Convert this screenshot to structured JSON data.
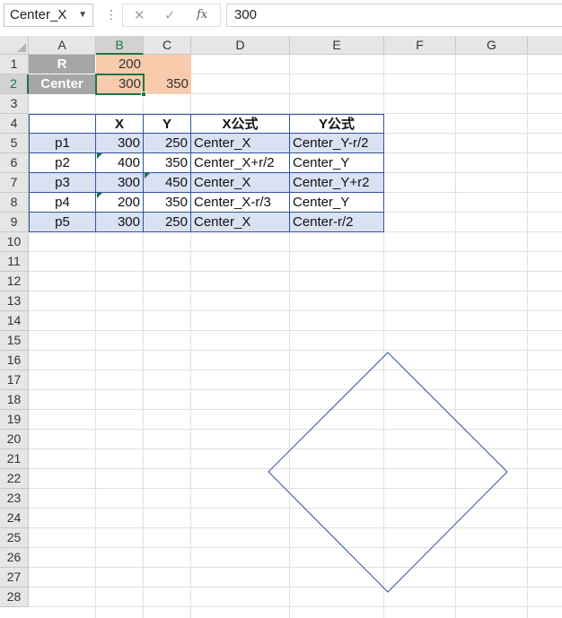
{
  "namebox": {
    "value": "Center_X"
  },
  "formula_bar": {
    "cancel_icon": "✕",
    "enter_icon": "✓",
    "fx_label": "fx",
    "value": "300"
  },
  "columns": [
    "A",
    "B",
    "C",
    "D",
    "E",
    "F",
    "G"
  ],
  "rows": [
    "1",
    "2",
    "3",
    "4",
    "5",
    "6",
    "7",
    "8",
    "9",
    "10",
    "11",
    "12",
    "13",
    "14",
    "15",
    "16",
    "17",
    "18",
    "19",
    "20",
    "21",
    "22",
    "23",
    "24",
    "25",
    "26",
    "27",
    "28"
  ],
  "params": {
    "r_label": "R",
    "r_value": "200",
    "center_label": "Center",
    "center_x": "300",
    "center_y": "350"
  },
  "table": {
    "headers": [
      "",
      "X",
      "Y",
      "X公式",
      "Y公式"
    ],
    "rows": [
      [
        "p1",
        "300",
        "250",
        "Center_X",
        "Center_Y-r/2"
      ],
      [
        "p2",
        "400",
        "350",
        "Center_X+r/2",
        "Center_Y"
      ],
      [
        "p3",
        "300",
        "450",
        "Center_X",
        "Center_Y+r2"
      ],
      [
        "p4",
        "200",
        "350",
        "Center_X-r/3",
        "Center_Y"
      ],
      [
        "p5",
        "300",
        "250",
        "Center_X",
        "Center-r/2"
      ]
    ]
  },
  "shape": {
    "type": "diamond",
    "stroke": "#2f5597"
  },
  "colors": {
    "accent": "#217346",
    "table_border": "#2f5597",
    "band": "#d9e1f2",
    "param_label_bg": "#a6a6a6",
    "param_value_bg": "#f8cbad"
  }
}
